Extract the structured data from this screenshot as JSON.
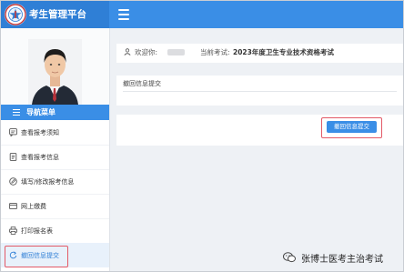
{
  "app": {
    "title": "考生管理平台",
    "logo_icon": "emblem-icon"
  },
  "header": {
    "menu_toggle_icon": "hamburger-icon"
  },
  "sidebar": {
    "nav_title": "导航菜单",
    "items": [
      {
        "label": "查看报考须知",
        "icon": "notice-icon"
      },
      {
        "label": "查看报考信息",
        "icon": "document-icon"
      },
      {
        "label": "填写/修改报考信息",
        "icon": "edit-icon"
      },
      {
        "label": "网上缴费",
        "icon": "payment-icon"
      },
      {
        "label": "打印报名表",
        "icon": "printer-icon"
      },
      {
        "label": "撤回信息提交",
        "icon": "undo-icon",
        "active": true
      }
    ]
  },
  "main": {
    "welcome_label": "欢迎你:",
    "exam_label": "当前考试:",
    "exam_value": "2023年度卫生专业技术资格考试",
    "section_title": "撤回信息提交",
    "submit_button": "撤回信息提交"
  },
  "watermark": {
    "text": "张博士医考主治考试"
  },
  "colors": {
    "primary": "#3a8ee6",
    "brand": "#2f7fd6",
    "highlight": "#e35a67",
    "active_bg": "#e8f1fb"
  }
}
